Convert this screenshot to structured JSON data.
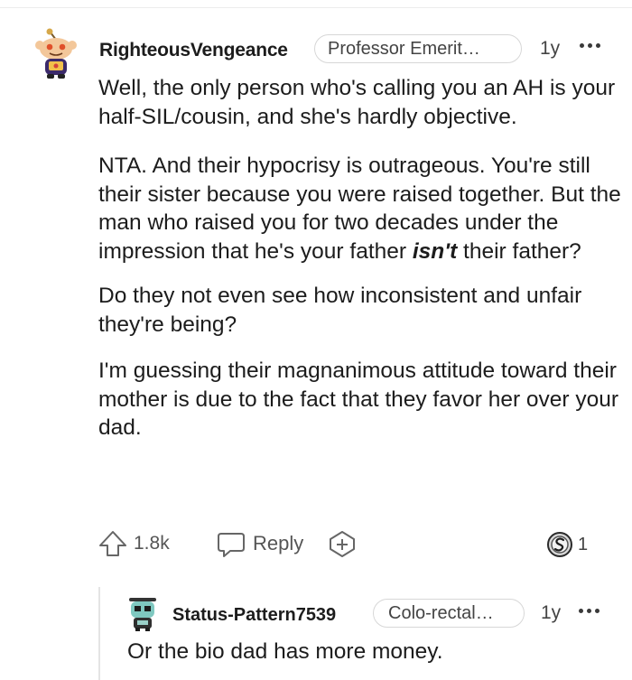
{
  "comment": {
    "username": "RighteousVengeance",
    "flair": "Professor Emerit…",
    "age": "1y",
    "paragraphs": {
      "p1": "Well, the only person who's calling you an AH is your half-SIL/cousin, and she's hardly objective.",
      "p2_before": "NTA. And their hypocrisy is outrageous. You're still their sister because you were raised together. But the man who raised you for two decades under the impression that he's your father ",
      "p2_emph": "isn't",
      "p2_after": " their father?",
      "p3": "Do they not even see how inconsistent and unfair they're being?",
      "p4": "I'm guessing their magnanimous attitude toward their mother is due to the fact that they favor her over your dad."
    },
    "actions": {
      "score": "1.8k",
      "reply_label": "Reply",
      "award_count": "1"
    },
    "icons": {
      "avatar": "snoo-avatar-icon",
      "upvote": "upvote-arrow-icon",
      "reply": "reply-bubble-icon",
      "award": "add-award-icon",
      "award_badge": "silver-award-icon",
      "more": "more-options-icon"
    }
  },
  "reply": {
    "username": "Status-Pattern7539",
    "flair": "Colo-rectal…",
    "age": "1y",
    "body": "Or the bio dad has more money."
  },
  "colors": {
    "text": "#1c1c1c",
    "muted": "#555555",
    "border": "#d7d7d7"
  }
}
